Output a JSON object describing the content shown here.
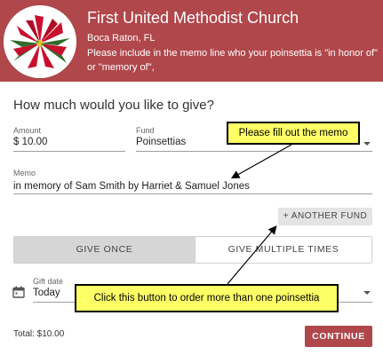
{
  "header": {
    "church_name": "First United Methodist Church",
    "location": "Boca Raton, FL",
    "note": "Please include in the memo line who your poinsettia is \"in honor of\" or \"memory of\",",
    "background_color": "#b0474b"
  },
  "form": {
    "question": "How much would you like to give?",
    "amount_label": "Amount",
    "amount_value": "$ 10.00",
    "fund_label": "Fund",
    "fund_value": "Poinsettias",
    "memo_label": "Memo",
    "memo_value": "in memory of Sam Smith by Harriet & Samuel Jones",
    "another_fund_label": "+ ANOTHER FUND",
    "give_once_label": "GIVE ONCE",
    "give_multiple_label": "GIVE MULTIPLE TIMES",
    "gift_date_label": "Gift date",
    "gift_date_value": "Today",
    "total": "Total: $10.00",
    "continue_label": "CONTINUE"
  },
  "annotations": {
    "memo_callout": "Please fill out the memo",
    "fund_callout": "Click this button to order more than one poinsettia",
    "callout_color": "#ffff66"
  },
  "icons": {
    "logo": "poinsettia-logo",
    "calendar": "calendar-icon",
    "dropdown": "chevron-down-icon"
  }
}
